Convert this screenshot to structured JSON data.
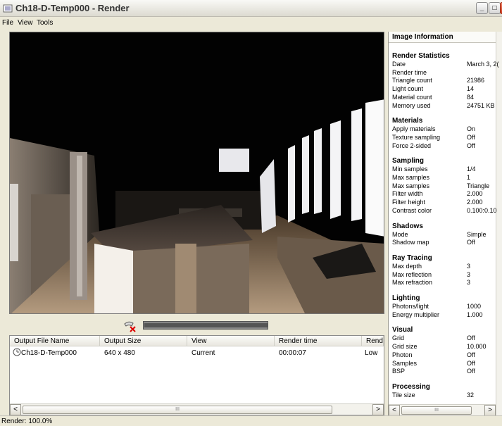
{
  "window": {
    "title": "Ch18-D-Temp000 - Render"
  },
  "menu": {
    "items": [
      "File",
      "View",
      "Tools"
    ]
  },
  "progress": {
    "fraction": 1.0
  },
  "output_table": {
    "columns": [
      "Output File Name",
      "Output Size",
      "View",
      "Render time",
      "Render"
    ],
    "rows": [
      {
        "name": "Ch18-D-Temp000",
        "size": "640 x 480",
        "view": "Current",
        "time": "00:00:07",
        "quality": "Low"
      }
    ],
    "scroll_thumb_glyph": "III"
  },
  "info_panel": {
    "header": "Image Information",
    "sections": [
      {
        "title": "Render Statistics",
        "rows": [
          [
            "Date",
            "March 3, 2("
          ],
          [
            "Render time",
            ""
          ],
          [
            "Triangle count",
            "21986"
          ],
          [
            "Light count",
            "14"
          ],
          [
            "Material count",
            "84"
          ],
          [
            "Memory used",
            "24751 KB"
          ]
        ]
      },
      {
        "title": "Materials",
        "rows": [
          [
            "Apply materials",
            "On"
          ],
          [
            "Texture sampling",
            "Off"
          ],
          [
            "Force 2-sided",
            "Off"
          ]
        ]
      },
      {
        "title": "Sampling",
        "rows": [
          [
            "Min samples",
            "1/4"
          ],
          [
            "Max samples",
            "1"
          ],
          [
            "Max samples",
            "Triangle"
          ],
          [
            "Filter width",
            "2.000"
          ],
          [
            "Filter height",
            "2.000"
          ],
          [
            "Contrast color",
            "0.100:0.10"
          ]
        ]
      },
      {
        "title": "Shadows",
        "rows": [
          [
            "Mode",
            "Simple"
          ],
          [
            "Shadow map",
            "Off"
          ]
        ]
      },
      {
        "title": "Ray Tracing",
        "rows": [
          [
            "Max depth",
            "3"
          ],
          [
            "Max reflection",
            "3"
          ],
          [
            "Max refraction",
            "3"
          ]
        ]
      },
      {
        "title": "Lighting",
        "rows": [
          [
            "Photons/light",
            "1000"
          ],
          [
            "Energy multiplier",
            "1.000"
          ]
        ]
      },
      {
        "title": "Visual",
        "rows": [
          [
            "Grid",
            "Off"
          ],
          [
            "Grid size",
            "10.000"
          ],
          [
            "Photon",
            "Off"
          ],
          [
            "Samples",
            "Off"
          ],
          [
            "BSP",
            "Off"
          ]
        ]
      },
      {
        "title": "Processing",
        "rows": [
          [
            "Tile size",
            "32"
          ]
        ]
      }
    ]
  },
  "status": {
    "text": "Render: 100.0%"
  },
  "colors": {
    "chrome": "#ece9d8",
    "render_bg": "#020202",
    "close_red": "#cf3a1e"
  },
  "icons": [
    "app-icon",
    "minimize-icon",
    "maximize-icon",
    "close-icon",
    "progress-cancel-icon",
    "render-file-icon",
    "scroll-left-icon",
    "scroll-right-icon"
  ]
}
